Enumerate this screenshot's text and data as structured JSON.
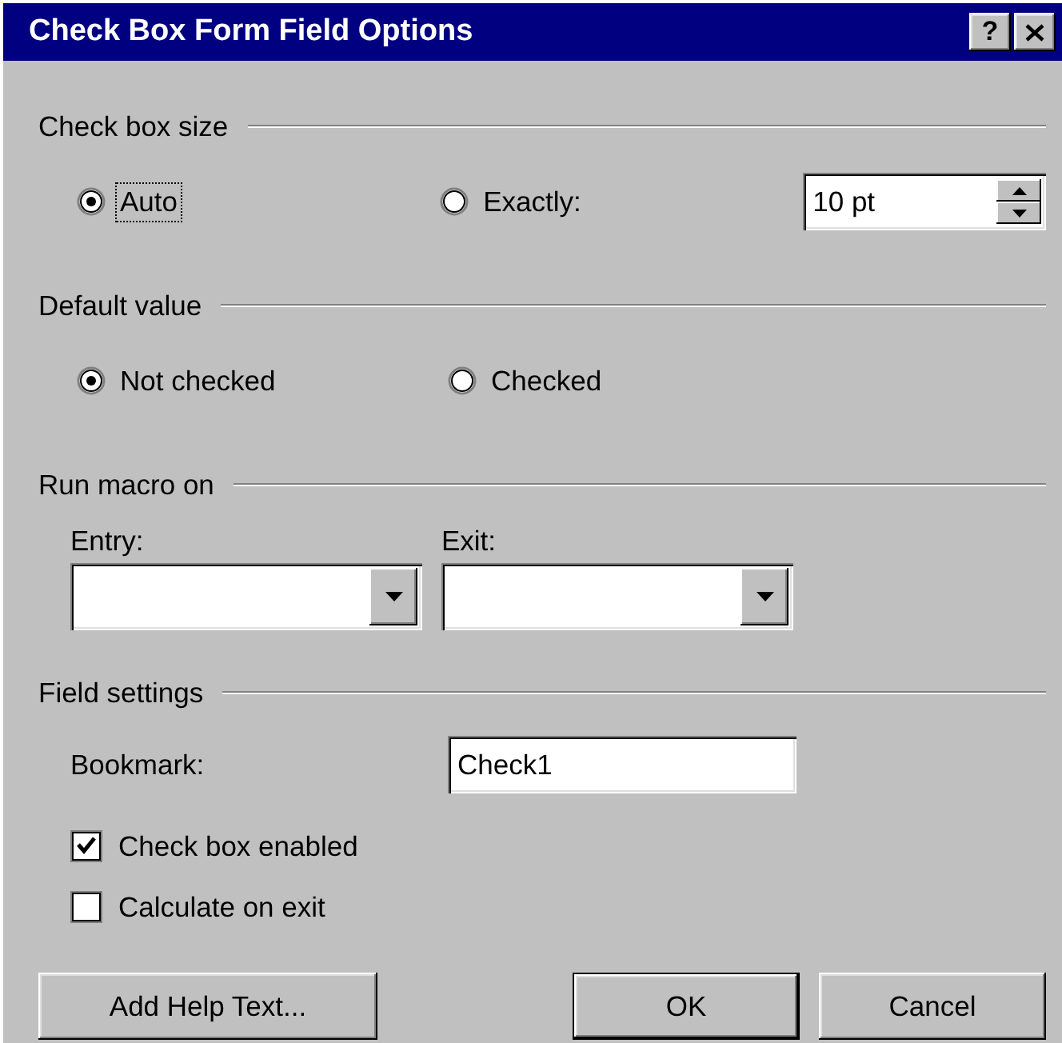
{
  "window": {
    "title": "Check Box Form Field Options",
    "help_button": "?"
  },
  "check_box_size": {
    "heading": "Check box size",
    "options": [
      {
        "label": "Auto",
        "selected": true,
        "focused": true
      },
      {
        "label": "Exactly:",
        "selected": false,
        "focused": false
      }
    ],
    "size_field": {
      "value": "10 pt"
    }
  },
  "default_value": {
    "heading": "Default value",
    "options": [
      {
        "label": "Not checked",
        "selected": true,
        "focused": false
      },
      {
        "label": "Checked",
        "selected": false,
        "focused": false
      }
    ]
  },
  "run_macro_on": {
    "heading": "Run macro on",
    "dropdowns": [
      {
        "label": "Entry:"
      },
      {
        "label": "Exit:"
      }
    ]
  },
  "field_settings": {
    "heading": "Field settings",
    "bookmark": {
      "label": "Bookmark:",
      "value": "Check1"
    },
    "checkboxes": [
      {
        "label": "Check box enabled",
        "checked": true
      },
      {
        "label": "Calculate on exit",
        "checked": false
      }
    ]
  },
  "buttons": [
    {
      "label": "Add Help Text...",
      "default": false
    },
    {
      "label": "OK",
      "default": true
    },
    {
      "label": "Cancel",
      "default": false
    }
  ]
}
